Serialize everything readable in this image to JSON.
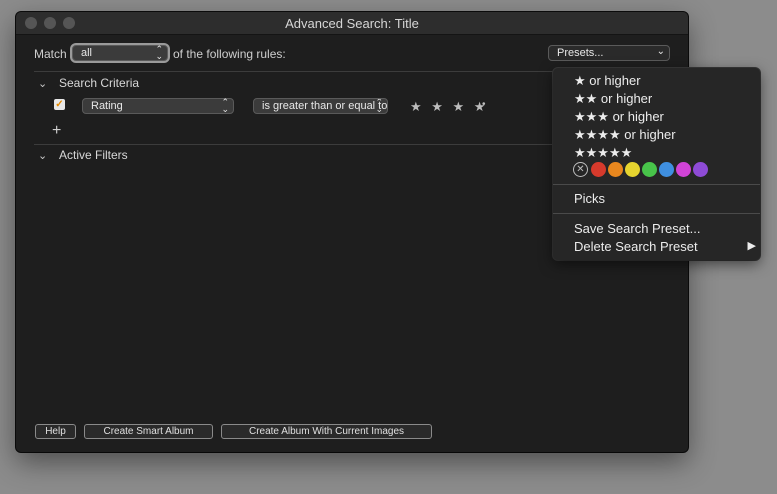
{
  "window": {
    "title": "Advanced Search: Title"
  },
  "match": {
    "prefix": "Match",
    "value": "all",
    "suffix": "of the following rules:"
  },
  "presets_label": "Presets...",
  "sections": {
    "criteria": "Search Criteria",
    "filters": "Active Filters"
  },
  "rule": {
    "field": "Rating",
    "operator": "is greater than or equal to",
    "stars": "★ ★ ★ ★",
    "dot": "•",
    "checked": true
  },
  "buttons": {
    "help": "Help",
    "smart_album": "Create Smart Album",
    "album_current": "Create Album With Current Images"
  },
  "presets_menu": {
    "items": [
      "★ or higher",
      "★★ or higher",
      "★★★ or higher",
      "★★★★ or higher",
      "★★★★★"
    ],
    "color_labels": [
      "#d63a2c",
      "#e8871e",
      "#e6d42f",
      "#48c44a",
      "#3f8fe0",
      "#d043d6",
      "#8e4bd6"
    ],
    "picks": "Picks",
    "save": "Save Search Preset...",
    "delete": "Delete Search Preset",
    "submenu_arrow": "▶"
  },
  "icons": {
    "chevron": "⌄",
    "updown": "⌃⌄",
    "check": "✓",
    "plus": "+",
    "no_label": "✕"
  }
}
